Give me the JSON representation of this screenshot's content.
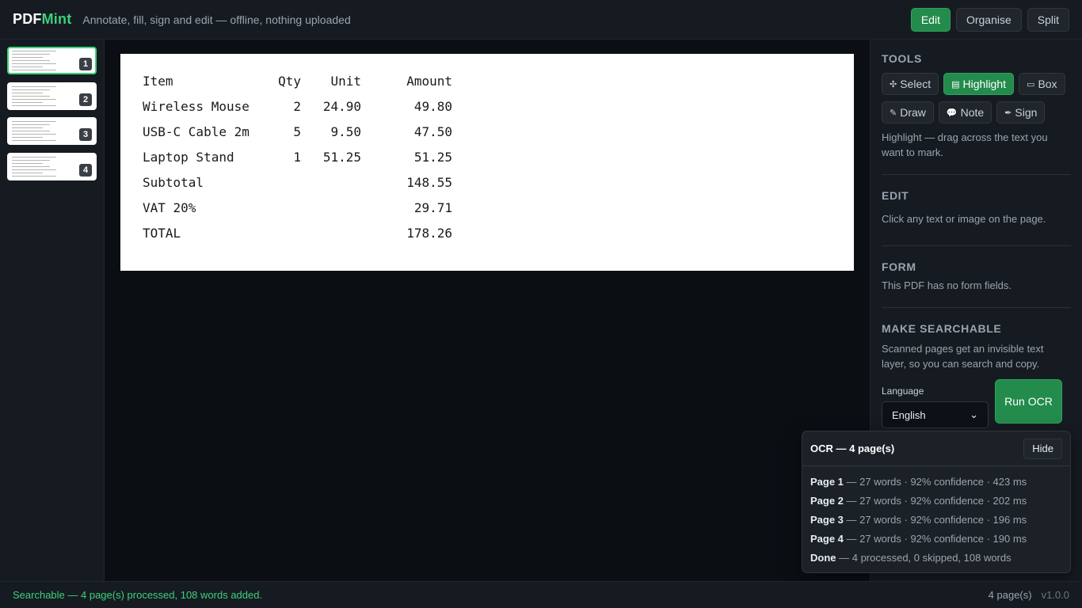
{
  "app": {
    "logo_part1": "PDF",
    "logo_part2": "Mint",
    "tagline": "Annotate, fill, sign and edit — offline, nothing uploaded"
  },
  "modes": [
    {
      "label": "Edit",
      "active": true
    },
    {
      "label": "Organise",
      "active": false
    },
    {
      "label": "Split",
      "active": false
    }
  ],
  "thumbnails": [
    {
      "number": "1",
      "active": true
    },
    {
      "number": "2",
      "active": false
    },
    {
      "number": "3",
      "active": false
    },
    {
      "number": "4",
      "active": false
    }
  ],
  "document": {
    "header": {
      "item": "Item",
      "qty": "Qty",
      "unit": "Unit",
      "amount": "Amount"
    },
    "rows": [
      {
        "item": "Wireless Mouse",
        "qty": "2",
        "unit": "24.90",
        "amount": "49.80"
      },
      {
        "item": "USB-C Cable 2m",
        "qty": "5",
        "unit": "9.50",
        "amount": "47.50"
      },
      {
        "item": "Laptop Stand",
        "qty": "1",
        "unit": "51.25",
        "amount": "51.25"
      },
      {
        "item": "Subtotal",
        "qty": "",
        "unit": "",
        "amount": "148.55"
      },
      {
        "item": "VAT 20%",
        "qty": "",
        "unit": "",
        "amount": "29.71"
      },
      {
        "item": "TOTAL",
        "qty": "",
        "unit": "",
        "amount": "178.26"
      }
    ]
  },
  "panel": {
    "tools": {
      "title": "TOOLS",
      "buttons": [
        {
          "label": "Select",
          "icon": "move-icon",
          "glyph": "✣",
          "active": false
        },
        {
          "label": "Highlight",
          "icon": "highlight-icon",
          "glyph": "▤",
          "active": true
        },
        {
          "label": "Box",
          "icon": "box-icon",
          "glyph": "▭",
          "active": false
        },
        {
          "label": "Draw",
          "icon": "pencil-icon",
          "glyph": "✎",
          "active": false
        },
        {
          "label": "Note",
          "icon": "speech-bubble-icon",
          "glyph": "💬",
          "active": false
        },
        {
          "label": "Sign",
          "icon": "pen-icon",
          "glyph": "✒",
          "active": false
        }
      ],
      "help": "Highlight — drag across the text you want to mark."
    },
    "edit": {
      "title": "EDIT",
      "help": "Click any text or image on the page."
    },
    "form": {
      "title": "FORM",
      "help": "This PDF has no form fields."
    },
    "searchable": {
      "title": "MAKE SEARCHABLE",
      "help": "Scanned pages get an invisible text layer, so you can search and copy.",
      "language_label": "Language",
      "language_value": "English",
      "run_label": "Run OCR"
    }
  },
  "ocr": {
    "title": "OCR — 4 page(s)",
    "hide_label": "Hide",
    "lines": [
      {
        "label": "Page 1",
        "text": " — 27 words · 92% confidence · 423 ms"
      },
      {
        "label": "Page 2",
        "text": " — 27 words · 92% confidence · 202 ms"
      },
      {
        "label": "Page 3",
        "text": " — 27 words · 92% confidence · 196 ms"
      },
      {
        "label": "Page 4",
        "text": " — 27 words · 92% confidence · 190 ms"
      },
      {
        "label": "Done",
        "text": " — 4 processed, 0 skipped, 108 words"
      }
    ]
  },
  "status": {
    "message": "Searchable — 4 page(s) processed, 108 words added.",
    "page_count": "4 page(s)",
    "version": "v1.0.0"
  },
  "colors": {
    "accent": "#3fd07a",
    "active_button": "#238b4c"
  }
}
